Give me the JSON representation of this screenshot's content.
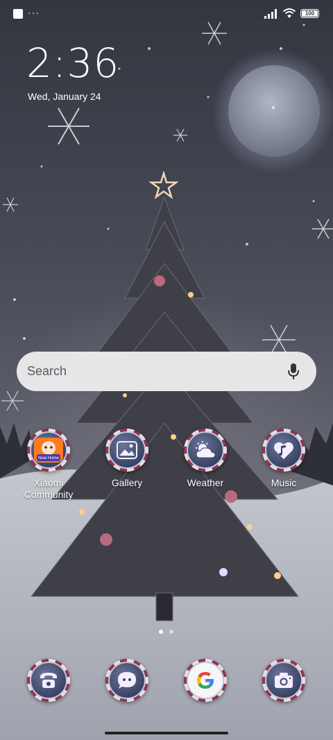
{
  "status_bar": {
    "notification_icon": "square-notification-icon",
    "more_indicator": "···",
    "signal_icon": "cellular-signal-icon",
    "wifi_icon": "wifi-icon",
    "battery_level": "100",
    "battery_fraction": 1.0
  },
  "clock": {
    "time": "2:36",
    "date": "Wed, January 24"
  },
  "search": {
    "placeholder": "Search",
    "mic_icon": "microphone-icon"
  },
  "apps": [
    {
      "label": "Xiaomi Community",
      "icon": "xiaomi-community-icon",
      "badge_text": "New Home"
    },
    {
      "label": "Gallery",
      "icon": "gallery-icon"
    },
    {
      "label": "Weather",
      "icon": "weather-icon"
    },
    {
      "label": "Music",
      "icon": "music-icon"
    }
  ],
  "dock": [
    {
      "name": "Phone",
      "icon": "phone-icon"
    },
    {
      "name": "Messages",
      "icon": "messages-icon"
    },
    {
      "name": "Google",
      "icon": "google-icon"
    },
    {
      "name": "Camera",
      "icon": "camera-icon"
    }
  ],
  "page_indicator": {
    "pages": 2,
    "current": 1
  },
  "colors": {
    "ring_light": "#e9dde3",
    "ring_dark": "#8d3552",
    "icon_bg": "#3b4466",
    "search_bg": "#eeeef0"
  }
}
